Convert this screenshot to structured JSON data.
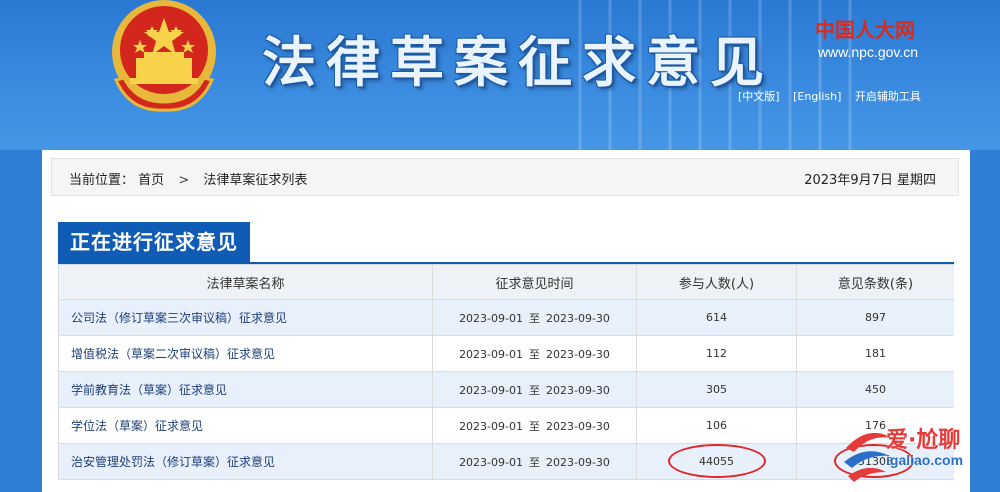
{
  "header": {
    "site_title": "法律草案征求意见",
    "npc_logo_text": "中国人大网",
    "npc_url": "www.npc.gov.cn",
    "lang_links": [
      "[中文版]",
      "[English]",
      "开启辅助工具"
    ]
  },
  "breadcrumb": {
    "prefix": "当前位置：",
    "items": [
      "首页",
      "法律草案征求列表"
    ],
    "separator": ">"
  },
  "date": "2023年9月7日  星期四",
  "section_title": "正在进行征求意见",
  "table": {
    "headers": [
      "法律草案名称",
      "征求意见时间",
      "参与人数(人)",
      "意见条数(条)"
    ],
    "to_label": "至",
    "rows": [
      {
        "name": "公司法（修订草案三次审议稿）征求意见",
        "start": "2023-09-01",
        "end": "2023-09-30",
        "participants": "614",
        "opinions": "897"
      },
      {
        "name": "增值税法（草案二次审议稿）征求意见",
        "start": "2023-09-01",
        "end": "2023-09-30",
        "participants": "112",
        "opinions": "181"
      },
      {
        "name": "学前教育法（草案）征求意见",
        "start": "2023-09-01",
        "end": "2023-09-30",
        "participants": "305",
        "opinions": "450"
      },
      {
        "name": "学位法（草案）征求意见",
        "start": "2023-09-01",
        "end": "2023-09-30",
        "participants": "106",
        "opinions": "176"
      },
      {
        "name": "治安管理处罚法（修订草案）征求意见",
        "start": "2023-09-01",
        "end": "2023-09-30",
        "participants": "44055",
        "opinions": "51303"
      }
    ]
  },
  "watermark": {
    "text": "爱·尬聊",
    "url": "igaliao.com"
  },
  "colors": {
    "banner_blue": "#2f7fd6",
    "title_bar_blue": "#0f5bb5",
    "row_tint": "#e8f0fb",
    "highlight_red": "#e02626",
    "npc_red": "#d62c20"
  }
}
